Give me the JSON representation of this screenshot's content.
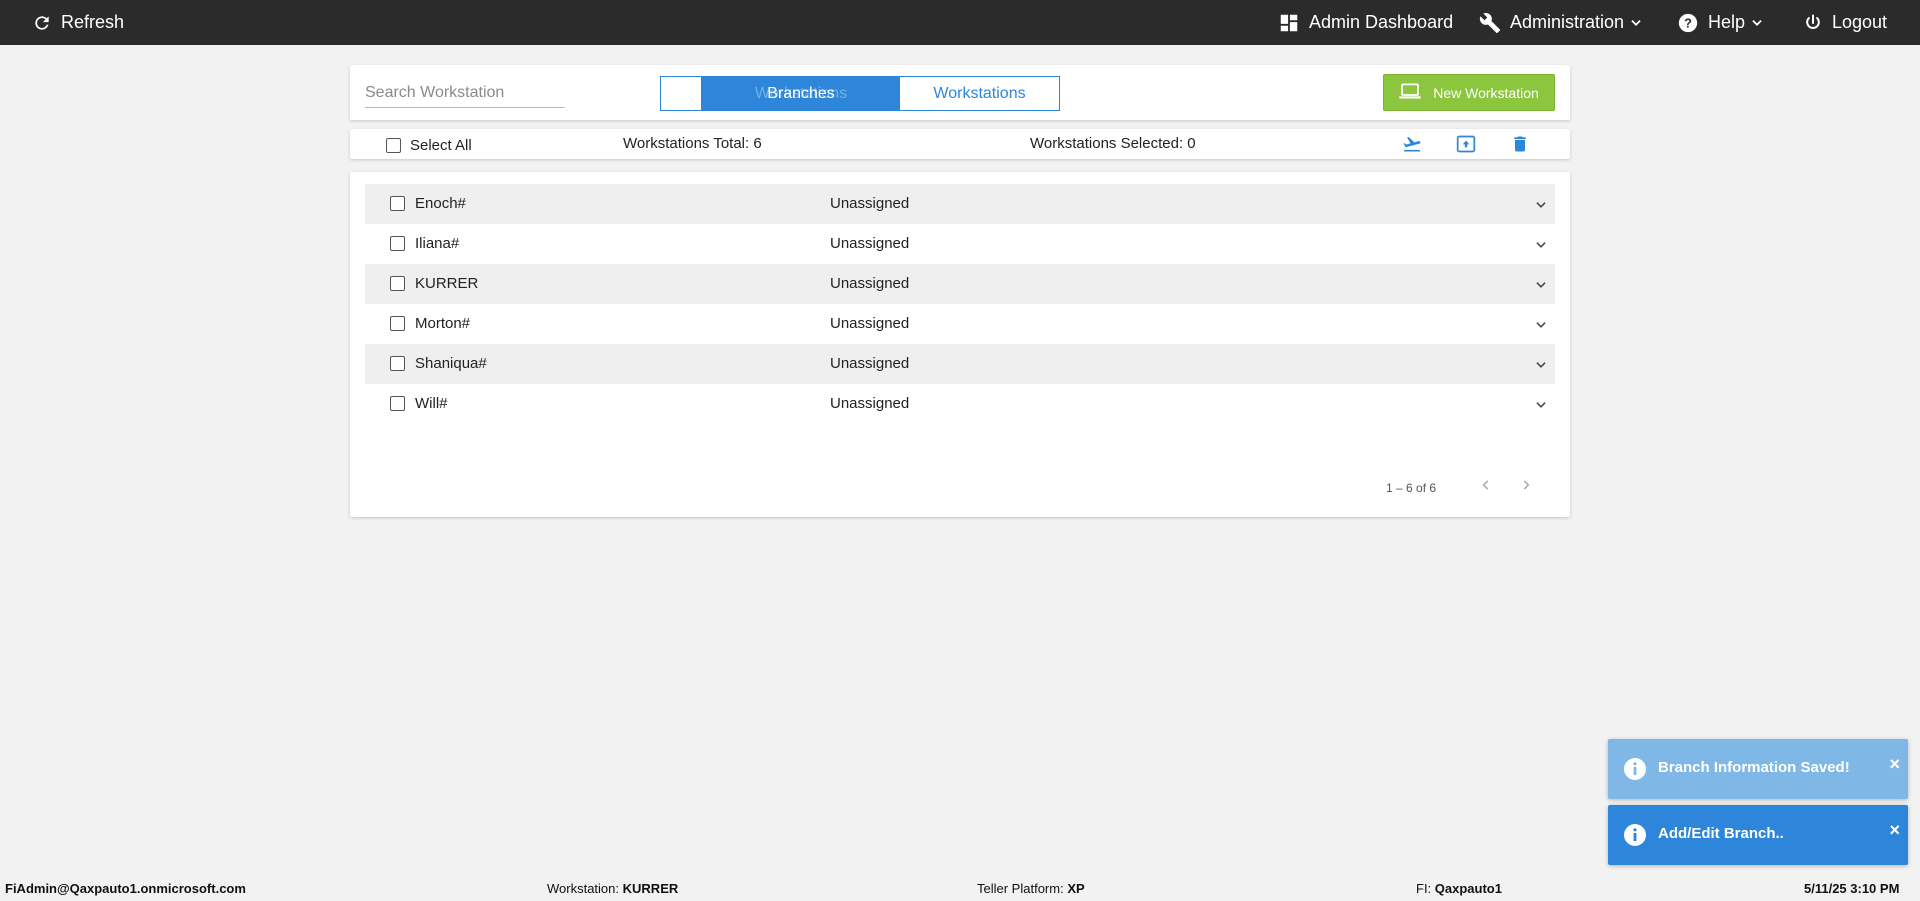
{
  "topbar": {
    "refresh_label": "Refresh",
    "admin_dashboard_label": "Admin Dashboard",
    "administration_label": "Administration",
    "help_label": "Help",
    "logout_label": "Logout",
    "icons": {
      "refresh": "refresh-icon",
      "dashboard": "dashboard-icon",
      "administration": "wrench-icon",
      "help": "help-icon",
      "logout": "power-icon"
    }
  },
  "search": {
    "placeholder": "Search Workstation",
    "value": ""
  },
  "toggle": {
    "active_label": "Branches",
    "active_ghost_label": "Workstations",
    "inactive_label": "Workstations"
  },
  "new_button": {
    "label": "New Workstation",
    "icon": "laptop-icon"
  },
  "toolbar": {
    "select_all_label": "Select All",
    "total_label": "Workstations Total: 6",
    "selected_label": "Workstations Selected: 0",
    "icons": [
      "flight-takeoff-icon",
      "upload-icon",
      "delete-icon"
    ]
  },
  "workstations": [
    {
      "name": "Enoch#",
      "status": "Unassigned"
    },
    {
      "name": "Iliana#",
      "status": "Unassigned"
    },
    {
      "name": "KURRER",
      "status": "Unassigned"
    },
    {
      "name": "Morton#",
      "status": "Unassigned"
    },
    {
      "name": "Shaniqua#",
      "status": "Unassigned"
    },
    {
      "name": "Will#",
      "status": "Unassigned"
    }
  ],
  "pager": {
    "range_label": "1 – 6 of 6"
  },
  "toasts": [
    {
      "text": "Branch Information Saved!",
      "close": "×",
      "color": "#7fb8e6"
    },
    {
      "text": "Add/Edit Branch..",
      "close": "×",
      "color": "#2d86d9"
    }
  ],
  "statusbar": {
    "user": "FiAdmin@Qaxpauto1.onmicrosoft.com",
    "workstation_label": "Workstation:",
    "workstation_value": "KURRER",
    "platform_label": "Teller Platform:",
    "platform_value": "XP",
    "fi_label": "FI:",
    "fi_value": "Qaxpauto1",
    "datetime": "5/11/25 3:10 PM"
  },
  "colors": {
    "topbar": "#2b2b2b",
    "accent": "#2d86d9",
    "new_button": "#8cc63e",
    "row_stripe": "#efefef",
    "background": "#f2f2f2"
  }
}
